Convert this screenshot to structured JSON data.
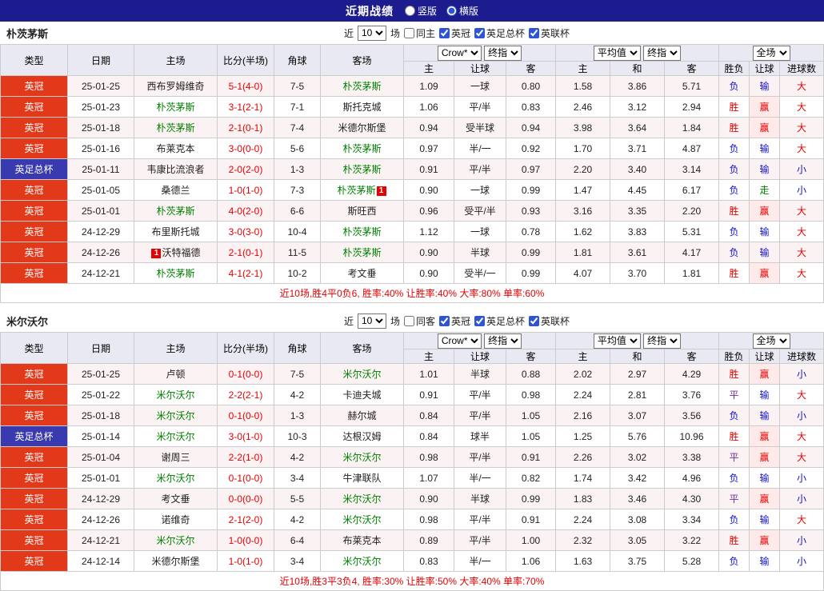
{
  "topbar": {
    "title": "近期战绩",
    "options": [
      {
        "label": "竖版",
        "selected": false
      },
      {
        "label": "横版",
        "selected": true
      }
    ]
  },
  "labels": {
    "near": "近",
    "games": "场",
    "leagues": [
      "英冠",
      "英足总杯",
      "英联杯"
    ]
  },
  "table_header": {
    "type": "类型",
    "date": "日期",
    "home": "主场",
    "score": "比分(半场)",
    "corner": "角球",
    "away": "客场",
    "g1s1": "Crow*",
    "g1s2": "终指",
    "g1c1": "主",
    "g1c2": "让球",
    "g1c3": "客",
    "g2s1": "平均值",
    "g2s2": "终指",
    "g2c1": "主",
    "g2c2": "和",
    "g2c3": "客",
    "g3s1": "全场",
    "g3c1": "胜负",
    "g3c2": "让球",
    "g3c3": "进球数"
  },
  "colors": {
    "topbar_bg": "#1d1c8e",
    "league_badge": "#e2391b",
    "cup_badge": "#3a3ab0",
    "self_team_green": "#008000",
    "score_red": "#e60000",
    "win_red": "#e60000",
    "lose_blue": "#1010d0",
    "draw_purple": "#7030a0",
    "push_green": "#008000",
    "header_bg": "#e9e9f3",
    "stripe_pink": "#fbf3f3"
  },
  "sections": [
    {
      "team": "朴茨茅斯",
      "count": "10",
      "same_side": "同主",
      "summary": "近10场,胜4平0负6, 胜率:40% 让胜率:40% 大率:80% 单率:60%",
      "rows": [
        {
          "lg": "英冠",
          "date": "25-01-25",
          "home": "西布罗姆维奇",
          "score": "5-1(4-0)",
          "corner": "7-5",
          "away": "朴茨茅斯",
          "aSelf": true,
          "o1": [
            "1.09",
            "一球",
            "0.80"
          ],
          "o2": [
            "1.58",
            "3.86",
            "5.71"
          ],
          "res": [
            "负",
            "输",
            "大"
          ]
        },
        {
          "lg": "英冠",
          "date": "25-01-23",
          "home": "朴茨茅斯",
          "hSelf": true,
          "score": "3-1(2-1)",
          "corner": "7-1",
          "away": "斯托克城",
          "o1": [
            "1.06",
            "平/半",
            "0.83"
          ],
          "o2": [
            "2.46",
            "3.12",
            "2.94"
          ],
          "res": [
            "胜",
            "赢",
            "大"
          ]
        },
        {
          "lg": "英冠",
          "date": "25-01-18",
          "home": "朴茨茅斯",
          "hSelf": true,
          "score": "2-1(0-1)",
          "corner": "7-4",
          "away": "米德尔斯堡",
          "o1": [
            "0.94",
            "受半球",
            "0.94"
          ],
          "o2": [
            "3.98",
            "3.64",
            "1.84"
          ],
          "res": [
            "胜",
            "赢",
            "大"
          ]
        },
        {
          "lg": "英冠",
          "date": "25-01-16",
          "home": "布莱克本",
          "score": "3-0(0-0)",
          "corner": "5-6",
          "away": "朴茨茅斯",
          "aSelf": true,
          "o1": [
            "0.97",
            "半/一",
            "0.92"
          ],
          "o2": [
            "1.70",
            "3.71",
            "4.87"
          ],
          "res": [
            "负",
            "输",
            "大"
          ]
        },
        {
          "lg": "英足总杯",
          "cup": true,
          "date": "25-01-11",
          "home": "韦康比流浪者",
          "score": "2-0(2-0)",
          "corner": "1-3",
          "away": "朴茨茅斯",
          "aSelf": true,
          "o1": [
            "0.91",
            "平/半",
            "0.97"
          ],
          "o2": [
            "2.20",
            "3.40",
            "3.14"
          ],
          "res": [
            "负",
            "输",
            "小"
          ]
        },
        {
          "lg": "英冠",
          "date": "25-01-05",
          "home": "桑德兰",
          "score": "1-0(1-0)",
          "corner": "7-3",
          "away": "朴茨茅斯",
          "aSelf": true,
          "aCard": "1",
          "aPos": "after",
          "o1": [
            "0.90",
            "一球",
            "0.99"
          ],
          "o2": [
            "1.47",
            "4.45",
            "6.17"
          ],
          "res": [
            "负",
            "走",
            "小"
          ]
        },
        {
          "lg": "英冠",
          "date": "25-01-01",
          "home": "朴茨茅斯",
          "hSelf": true,
          "score": "4-0(2-0)",
          "corner": "6-6",
          "away": "斯旺西",
          "o1": [
            "0.96",
            "受平/半",
            "0.93"
          ],
          "o2": [
            "3.16",
            "3.35",
            "2.20"
          ],
          "res": [
            "胜",
            "赢",
            "大"
          ]
        },
        {
          "lg": "英冠",
          "date": "24-12-29",
          "home": "布里斯托城",
          "score": "3-0(3-0)",
          "corner": "10-4",
          "away": "朴茨茅斯",
          "aSelf": true,
          "o1": [
            "1.12",
            "一球",
            "0.78"
          ],
          "o2": [
            "1.62",
            "3.83",
            "5.31"
          ],
          "res": [
            "负",
            "输",
            "大"
          ]
        },
        {
          "lg": "英冠",
          "date": "24-12-26",
          "home": "沃特福德",
          "hCard": "1",
          "hPos": "before",
          "score": "2-1(0-1)",
          "corner": "11-5",
          "away": "朴茨茅斯",
          "aSelf": true,
          "o1": [
            "0.90",
            "半球",
            "0.99"
          ],
          "o2": [
            "1.81",
            "3.61",
            "4.17"
          ],
          "res": [
            "负",
            "输",
            "大"
          ]
        },
        {
          "lg": "英冠",
          "date": "24-12-21",
          "home": "朴茨茅斯",
          "hSelf": true,
          "score": "4-1(2-1)",
          "corner": "10-2",
          "away": "考文垂",
          "o1": [
            "0.90",
            "受半/一",
            "0.99"
          ],
          "o2": [
            "4.07",
            "3.70",
            "1.81"
          ],
          "res": [
            "胜",
            "赢",
            "大"
          ]
        }
      ]
    },
    {
      "team": "米尔沃尔",
      "count": "10",
      "same_side": "同客",
      "summary": "近10场,胜3平3负4, 胜率:30% 让胜率:50% 大率:40% 单率:70%",
      "rows": [
        {
          "lg": "英冠",
          "date": "25-01-25",
          "home": "卢顿",
          "score": "0-1(0-0)",
          "corner": "7-5",
          "away": "米尔沃尔",
          "aSelf": true,
          "o1": [
            "1.01",
            "半球",
            "0.88"
          ],
          "o2": [
            "2.02",
            "2.97",
            "4.29"
          ],
          "res": [
            "胜",
            "赢",
            "小"
          ]
        },
        {
          "lg": "英冠",
          "date": "25-01-22",
          "home": "米尔沃尔",
          "hSelf": true,
          "score": "2-2(2-1)",
          "corner": "4-2",
          "away": "卡迪夫城",
          "o1": [
            "0.91",
            "平/半",
            "0.98"
          ],
          "o2": [
            "2.24",
            "2.81",
            "3.76"
          ],
          "res": [
            "平",
            "输",
            "大"
          ]
        },
        {
          "lg": "英冠",
          "date": "25-01-18",
          "home": "米尔沃尔",
          "hSelf": true,
          "score": "0-1(0-0)",
          "corner": "1-3",
          "away": "赫尔城",
          "o1": [
            "0.84",
            "平/半",
            "1.05"
          ],
          "o2": [
            "2.16",
            "3.07",
            "3.56"
          ],
          "res": [
            "负",
            "输",
            "小"
          ]
        },
        {
          "lg": "英足总杯",
          "cup": true,
          "date": "25-01-14",
          "home": "米尔沃尔",
          "hSelf": true,
          "score": "3-0(1-0)",
          "corner": "10-3",
          "away": "达根汉姆",
          "o1": [
            "0.84",
            "球半",
            "1.05"
          ],
          "o2": [
            "1.25",
            "5.76",
            "10.96"
          ],
          "res": [
            "胜",
            "赢",
            "大"
          ]
        },
        {
          "lg": "英冠",
          "date": "25-01-04",
          "home": "谢周三",
          "score": "2-2(1-0)",
          "corner": "4-2",
          "away": "米尔沃尔",
          "aSelf": true,
          "o1": [
            "0.98",
            "平/半",
            "0.91"
          ],
          "o2": [
            "2.26",
            "3.02",
            "3.38"
          ],
          "res": [
            "平",
            "赢",
            "大"
          ]
        },
        {
          "lg": "英冠",
          "date": "25-01-01",
          "home": "米尔沃尔",
          "hSelf": true,
          "score": "0-1(0-0)",
          "corner": "3-4",
          "away": "牛津联队",
          "o1": [
            "1.07",
            "半/一",
            "0.82"
          ],
          "o2": [
            "1.74",
            "3.42",
            "4.96"
          ],
          "res": [
            "负",
            "输",
            "小"
          ]
        },
        {
          "lg": "英冠",
          "date": "24-12-29",
          "home": "考文垂",
          "score": "0-0(0-0)",
          "corner": "5-5",
          "away": "米尔沃尔",
          "aSelf": true,
          "o1": [
            "0.90",
            "半球",
            "0.99"
          ],
          "o2": [
            "1.83",
            "3.46",
            "4.30"
          ],
          "res": [
            "平",
            "赢",
            "小"
          ]
        },
        {
          "lg": "英冠",
          "date": "24-12-26",
          "home": "诺维奇",
          "score": "2-1(2-0)",
          "corner": "4-2",
          "away": "米尔沃尔",
          "aSelf": true,
          "o1": [
            "0.98",
            "平/半",
            "0.91"
          ],
          "o2": [
            "2.24",
            "3.08",
            "3.34"
          ],
          "res": [
            "负",
            "输",
            "大"
          ]
        },
        {
          "lg": "英冠",
          "date": "24-12-21",
          "home": "米尔沃尔",
          "hSelf": true,
          "score": "1-0(0-0)",
          "corner": "6-4",
          "away": "布莱克本",
          "o1": [
            "0.89",
            "平/半",
            "1.00"
          ],
          "o2": [
            "2.32",
            "3.05",
            "3.22"
          ],
          "res": [
            "胜",
            "赢",
            "小"
          ]
        },
        {
          "lg": "英冠",
          "date": "24-12-14",
          "home": "米德尔斯堡",
          "score": "1-0(1-0)",
          "corner": "3-4",
          "away": "米尔沃尔",
          "aSelf": true,
          "o1": [
            "0.83",
            "半/一",
            "1.06"
          ],
          "o2": [
            "1.63",
            "3.75",
            "5.28"
          ],
          "res": [
            "负",
            "输",
            "小"
          ]
        }
      ]
    }
  ]
}
